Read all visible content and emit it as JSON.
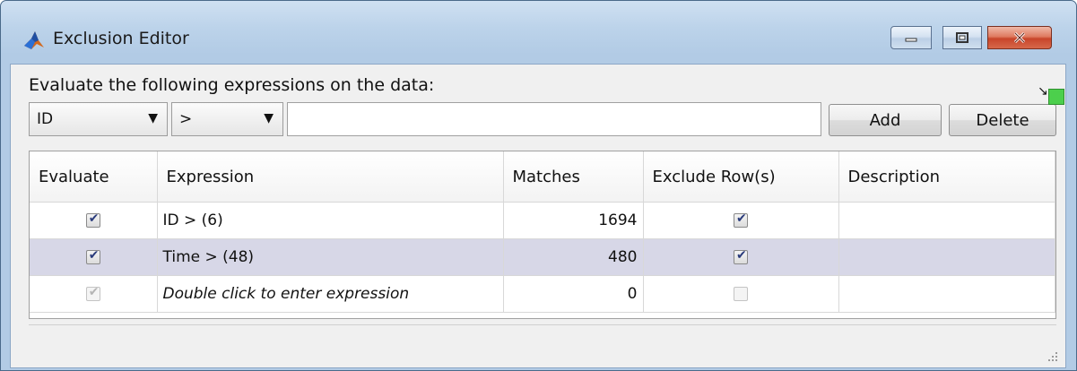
{
  "window": {
    "title": "Exclusion Editor",
    "icon": "matlab-membrane-icon",
    "controls": [
      "minimize-icon",
      "maximize-icon",
      "close-icon"
    ]
  },
  "toolbar": {
    "prompt": "Evaluate the following expressions on the data:",
    "field_select": "ID",
    "operator_select": ">",
    "expression_value": "",
    "add_label": "Add",
    "delete_label": "Delete"
  },
  "table": {
    "columns": [
      "Evaluate",
      "Expression",
      "Matches",
      "Exclude Row(s)",
      "Description"
    ],
    "rows": [
      {
        "evaluate": true,
        "expression": "ID > (6)",
        "matches": "1694",
        "exclude": true,
        "description": "",
        "selected": false,
        "placeholder": false
      },
      {
        "evaluate": true,
        "expression": "Time > (48)",
        "matches": "480",
        "exclude": true,
        "description": "",
        "selected": true,
        "placeholder": false
      },
      {
        "evaluate": true,
        "expression": "Double click to enter expression",
        "matches": "0",
        "exclude": false,
        "description": "",
        "selected": false,
        "placeholder": true
      }
    ]
  },
  "colors": {
    "selected_row": "#d7d7e7",
    "status_indicator": "#4ccf4c",
    "title_gradient": "#bcd3ea"
  }
}
